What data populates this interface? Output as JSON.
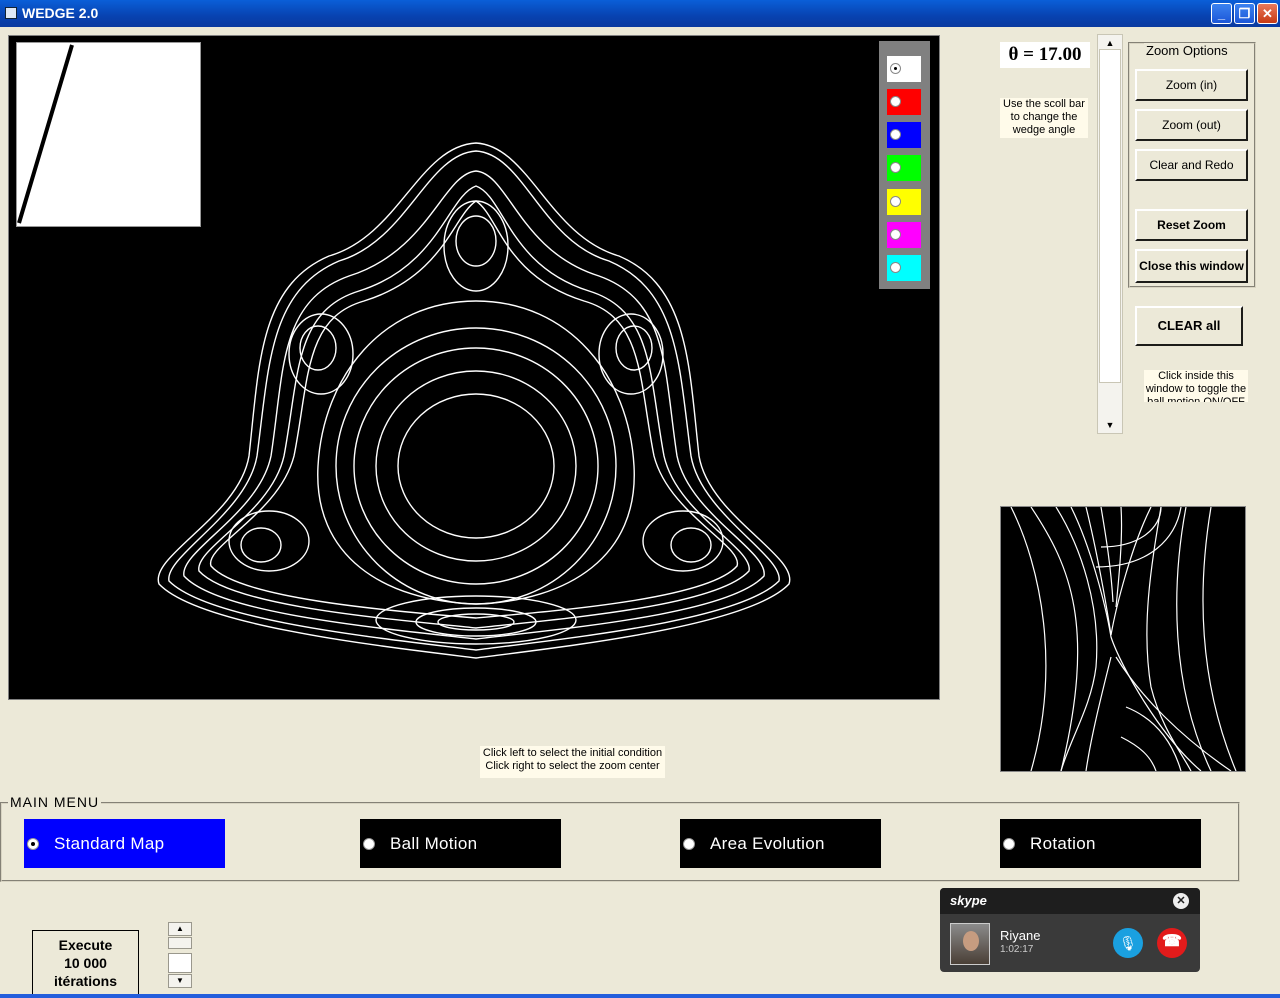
{
  "window": {
    "title": "WEDGE 2.0",
    "min_glyph": "_",
    "max_glyph": "❐",
    "close_glyph": "✕"
  },
  "palette": {
    "colors": [
      "#ffffff",
      "#ff0000",
      "#0000ff",
      "#00ff00",
      "#ffff00",
      "#ff00ff",
      "#00ffff"
    ],
    "selected_index": 0
  },
  "theta": {
    "display": "θ = 17.00"
  },
  "hints": {
    "scroll": "Use the scoll bar to change the wedge angle",
    "click_toggle": "Click inside this window to toggle the ball motion ON/OFF",
    "canvas_line1": "Click left to select the initial condition",
    "canvas_line2": "Click right to select the zoom center"
  },
  "zoom": {
    "legend": "Zoom Options",
    "zoom_in": "Zoom (in)",
    "zoom_out": "Zoom (out)",
    "clear_redo": "Clear and Redo",
    "reset": "Reset Zoom",
    "close": "Close this window"
  },
  "clear_all": "CLEAR all",
  "main_menu": {
    "legend": "MAIN  MENU",
    "items": [
      {
        "label": "Standard Map",
        "selected": true
      },
      {
        "label": "Ball Motion",
        "selected": false
      },
      {
        "label": "Area Evolution",
        "selected": false
      },
      {
        "label": "Rotation",
        "selected": false
      }
    ]
  },
  "execute": {
    "line1": "Execute",
    "line2": "10 000",
    "line3": "itérations"
  },
  "skype": {
    "brand": "skype",
    "caller": "Riyane",
    "duration": "1:02:17"
  }
}
